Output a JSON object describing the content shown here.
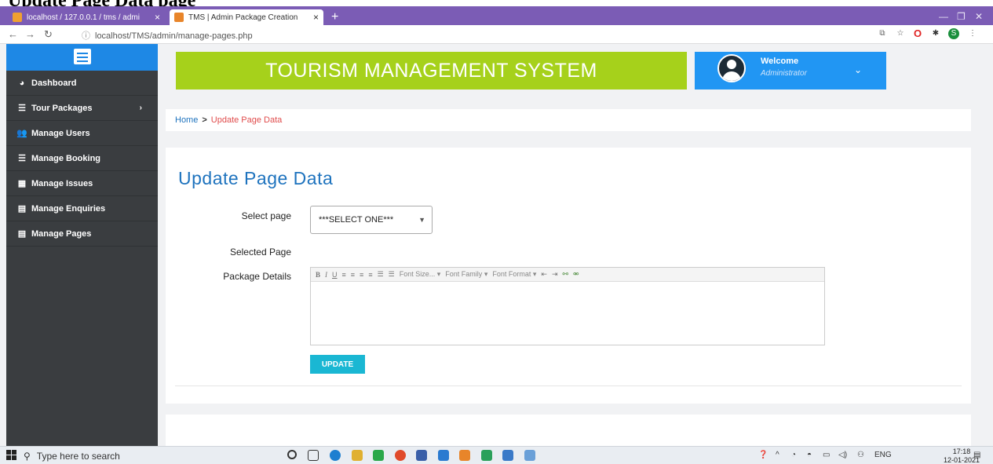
{
  "document_heading": "Update Page Data page",
  "browser": {
    "tabs": [
      {
        "label": "localhost / 127.0.0.1 / tms / admi",
        "close": "×"
      },
      {
        "label": "TMS | Admin Package Creation",
        "close": "×"
      }
    ],
    "new_tab": "+",
    "url": "localhost/TMS/admin/manage-pages.php"
  },
  "sidebar": {
    "items": [
      {
        "label": "Dashboard"
      },
      {
        "label": "Tour Packages",
        "caret": "›"
      },
      {
        "label": "Manage Users"
      },
      {
        "label": "Manage Booking"
      },
      {
        "label": "Manage Issues"
      },
      {
        "label": "Manage Enquiries"
      },
      {
        "label": "Manage Pages"
      }
    ]
  },
  "header": {
    "banner_title": "TOURISM MANAGEMENT SYSTEM",
    "welcome": "Welcome",
    "role": "Administrator"
  },
  "breadcrumb": {
    "home": "Home",
    "separator": ">",
    "current": "Update Page Data"
  },
  "form": {
    "title": "Update Page Data",
    "select_page_label": "Select page",
    "select_value": "***SELECT ONE***",
    "selected_page_label": "Selected Page",
    "package_details_label": "Package Details",
    "toolbar": {
      "font_size": "Font Size...",
      "font_family": "Font Family",
      "font_format": "Font Format"
    },
    "update_label": "UPDATE"
  },
  "taskbar": {
    "search_placeholder": "Type here to search",
    "lang": "ENG",
    "time": "17:18",
    "date": "12-01-2021"
  },
  "colors": {
    "banner": "#a6d11b",
    "welcome_box": "#2196f3",
    "sidebar": "#3a3d40",
    "title_blue": "#1e73be",
    "update_button": "#1ab7d3",
    "browser_bar": "#7b5cb5"
  }
}
